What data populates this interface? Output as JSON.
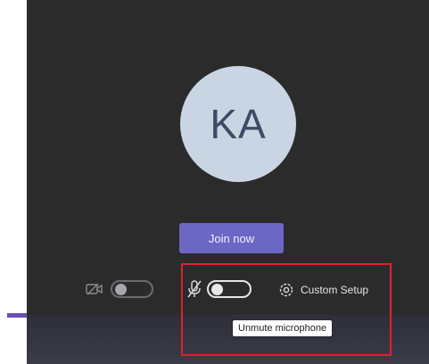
{
  "avatar": {
    "initials": "KA"
  },
  "join_button": {
    "label": "Join now"
  },
  "controls": {
    "video_toggle": {
      "icon": "video-off-icon",
      "state": "off"
    },
    "mic_toggle": {
      "icon": "mic-off-icon",
      "state": "off"
    },
    "settings": {
      "icon": "gear-icon",
      "label": "Custom Setup"
    }
  },
  "tooltip": {
    "text": "Unmute microphone"
  },
  "colors": {
    "panel_bg": "#2b2b2c",
    "accent": "#6c67c4",
    "accent_line": "#6b4fb2",
    "avatar_bg": "#c9d5e2",
    "avatar_text": "#3f4a66",
    "highlight": "#e0212b"
  }
}
